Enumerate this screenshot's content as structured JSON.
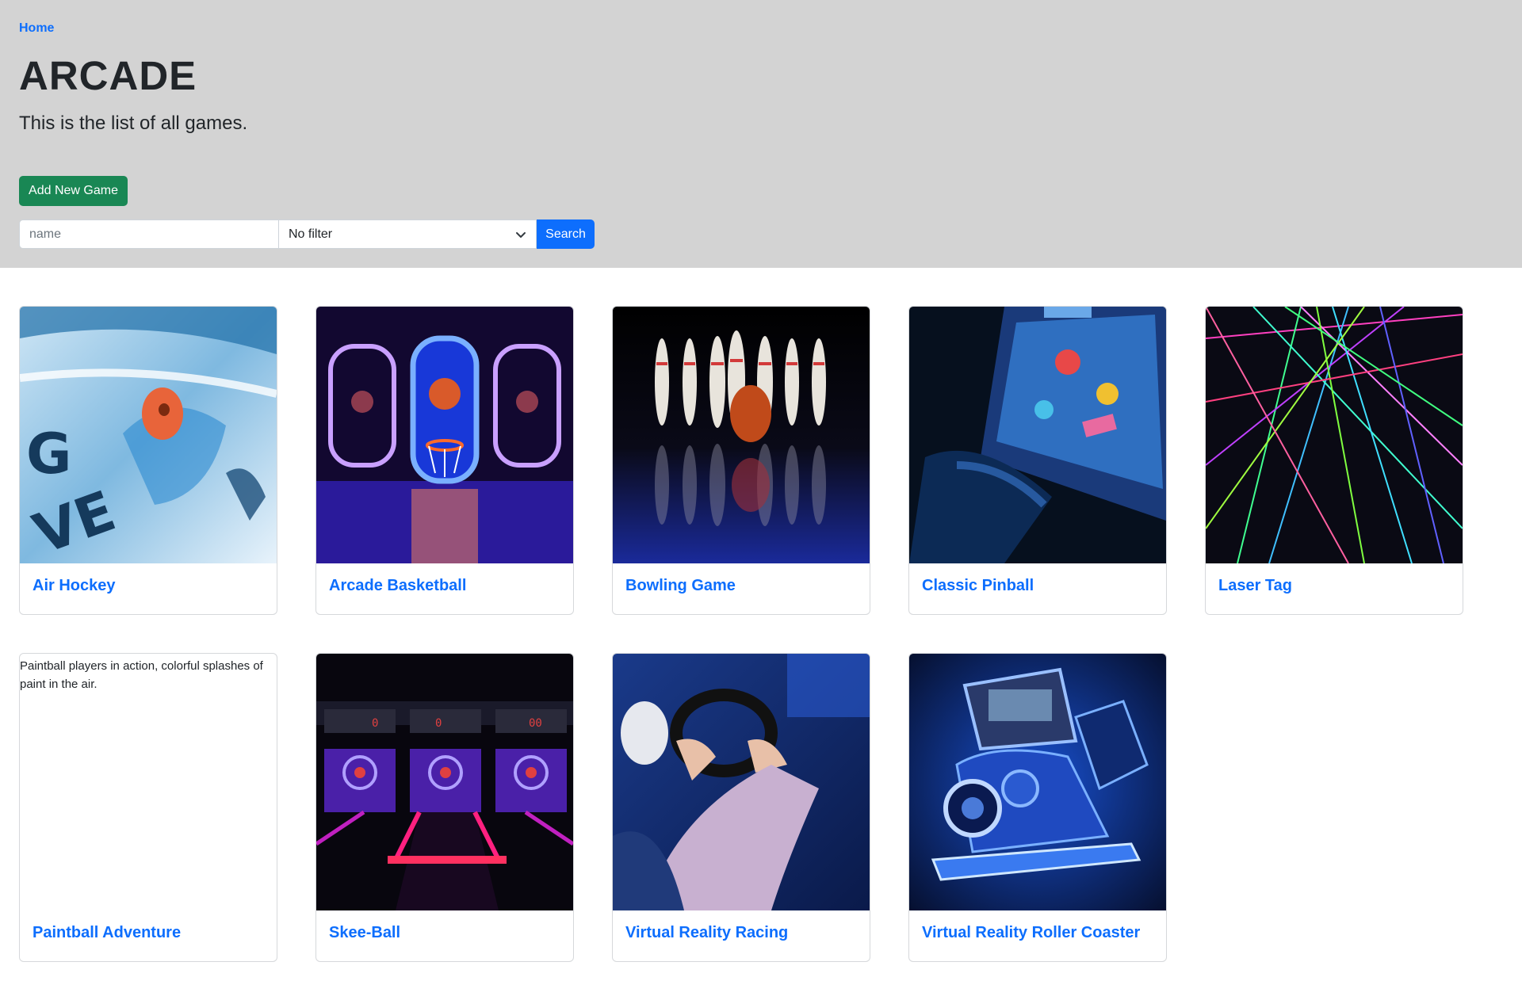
{
  "header": {
    "breadcrumb": "Home",
    "title": "ARCADE",
    "subtitle": "This is the list of all games."
  },
  "actions": {
    "add_label": "Add New Game"
  },
  "search": {
    "placeholder": "name",
    "filter_selected": "No filter",
    "button_label": "Search"
  },
  "colors": {
    "header_bg": "#d3d3d3",
    "link": "#0d6efd",
    "success": "#198754",
    "primary": "#0d6efd"
  },
  "games": [
    {
      "name": "Air Hockey",
      "image": "air-hockey-image"
    },
    {
      "name": "Arcade Basketball",
      "image": "arcade-basketball-image"
    },
    {
      "name": "Bowling Game",
      "image": "bowling-image"
    },
    {
      "name": "Classic Pinball",
      "image": "pinball-image"
    },
    {
      "name": "Laser Tag",
      "image": "laser-tag-image"
    },
    {
      "name": "Paintball Adventure",
      "image_alt": "Paintball players in action, colorful splashes of paint in the air."
    },
    {
      "name": "Skee-Ball",
      "image": "skee-ball-image"
    },
    {
      "name": "Virtual Reality Racing",
      "image": "vr-racing-image"
    },
    {
      "name": "Virtual Reality Roller Coaster",
      "image": "vr-roller-coaster-image"
    }
  ]
}
